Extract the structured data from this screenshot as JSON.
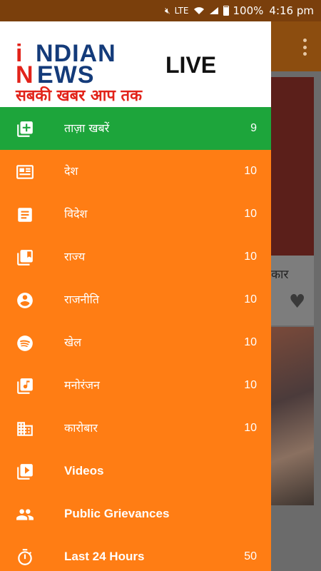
{
  "status_bar": {
    "network_label": "LTE",
    "battery": "100%",
    "time": "4:16 pm"
  },
  "drawer": {
    "logo": {
      "text_line1": "NDIAN",
      "text_line2": "EWS",
      "initial_i": "i",
      "initial_n": "N",
      "live": "LIVE",
      "tagline": "सबकी खबर आप तक"
    },
    "items": [
      {
        "label": "ताज़ा खबरें",
        "count": "9",
        "icon": "add-box-icon",
        "active": true
      },
      {
        "label": "देश",
        "count": "10",
        "icon": "newspaper-icon"
      },
      {
        "label": "विदेश",
        "count": "10",
        "icon": "article-icon"
      },
      {
        "label": "राज्य",
        "count": "10",
        "icon": "bookmark-book-icon"
      },
      {
        "label": "राजनीति",
        "count": "10",
        "icon": "account-circle-icon"
      },
      {
        "label": "खेल",
        "count": "10",
        "icon": "spotify-icon"
      },
      {
        "label": "मनोरंजन",
        "count": "10",
        "icon": "music-library-icon"
      },
      {
        "label": "कारोबार",
        "count": "10",
        "icon": "business-icon"
      },
      {
        "label": "Videos",
        "count": "",
        "icon": "video-library-icon"
      },
      {
        "label": "Public Grievances",
        "count": "",
        "icon": "people-icon"
      },
      {
        "label": "Last 24 Hours",
        "count": "50",
        "icon": "timer-icon"
      }
    ]
  },
  "background": {
    "card_text": "कार"
  },
  "colors": {
    "drawer_bg": "#ff7d14",
    "active_bg": "#1da53b",
    "toolbar_bg": "#8c4d0f",
    "logo_red": "#e2231a",
    "logo_blue": "#143b7a"
  }
}
